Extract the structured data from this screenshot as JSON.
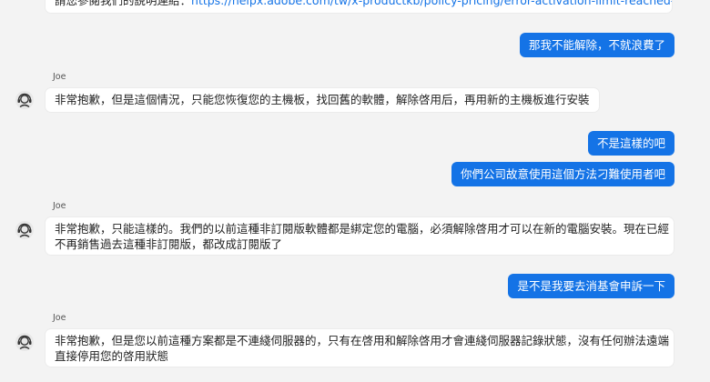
{
  "colors": {
    "background": "#f3f3f3",
    "user_bubble": "#1473e6",
    "agent_bubble": "#ffffff",
    "link": "#1473e6"
  },
  "messages": [
    {
      "from": "agent",
      "text_prefix": "請您參閱我們的說明連結：",
      "link": "https://helpx.adobe.com/tw/x-productkb/policy-pricing/error-activation-limit-reached-sign.html"
    },
    {
      "from": "user",
      "text": "那我不能解除，不就浪費了"
    },
    {
      "from": "agent",
      "sender": "Joe",
      "avatar_icon": "headset-agent-icon",
      "text": "非常抱歉，但是這個情況，只能您恢復您的主機板，找回舊的軟體，解除啓用后，再用新的主機板進行安裝"
    },
    {
      "from": "user",
      "text": "不是這樣的吧"
    },
    {
      "from": "user",
      "text": "你們公司故意使用這個方法刁難使用者吧"
    },
    {
      "from": "agent",
      "sender": "Joe",
      "avatar_icon": "headset-agent-icon",
      "line1": "非常抱歉，只能這樣的。我們的以前這種非訂閱版軟體都是綁定您的電腦，必須解除啓用才可以在新的電腦安裝。現在已經",
      "line2": "不再銷售過去這種非訂閱版，都改成訂閱版了"
    },
    {
      "from": "user",
      "text": "是不是我要去消基會申訴一下"
    },
    {
      "from": "agent",
      "sender": "Joe",
      "avatar_icon": "headset-agent-icon",
      "line1": "非常抱歉，但是您以前這種方案都是不連綫伺服器的，只有在啓用和解除啓用才會連綫伺服器記錄狀態，沒有任何辦法遠端",
      "line2": "直接停用您的啓用狀態"
    }
  ]
}
